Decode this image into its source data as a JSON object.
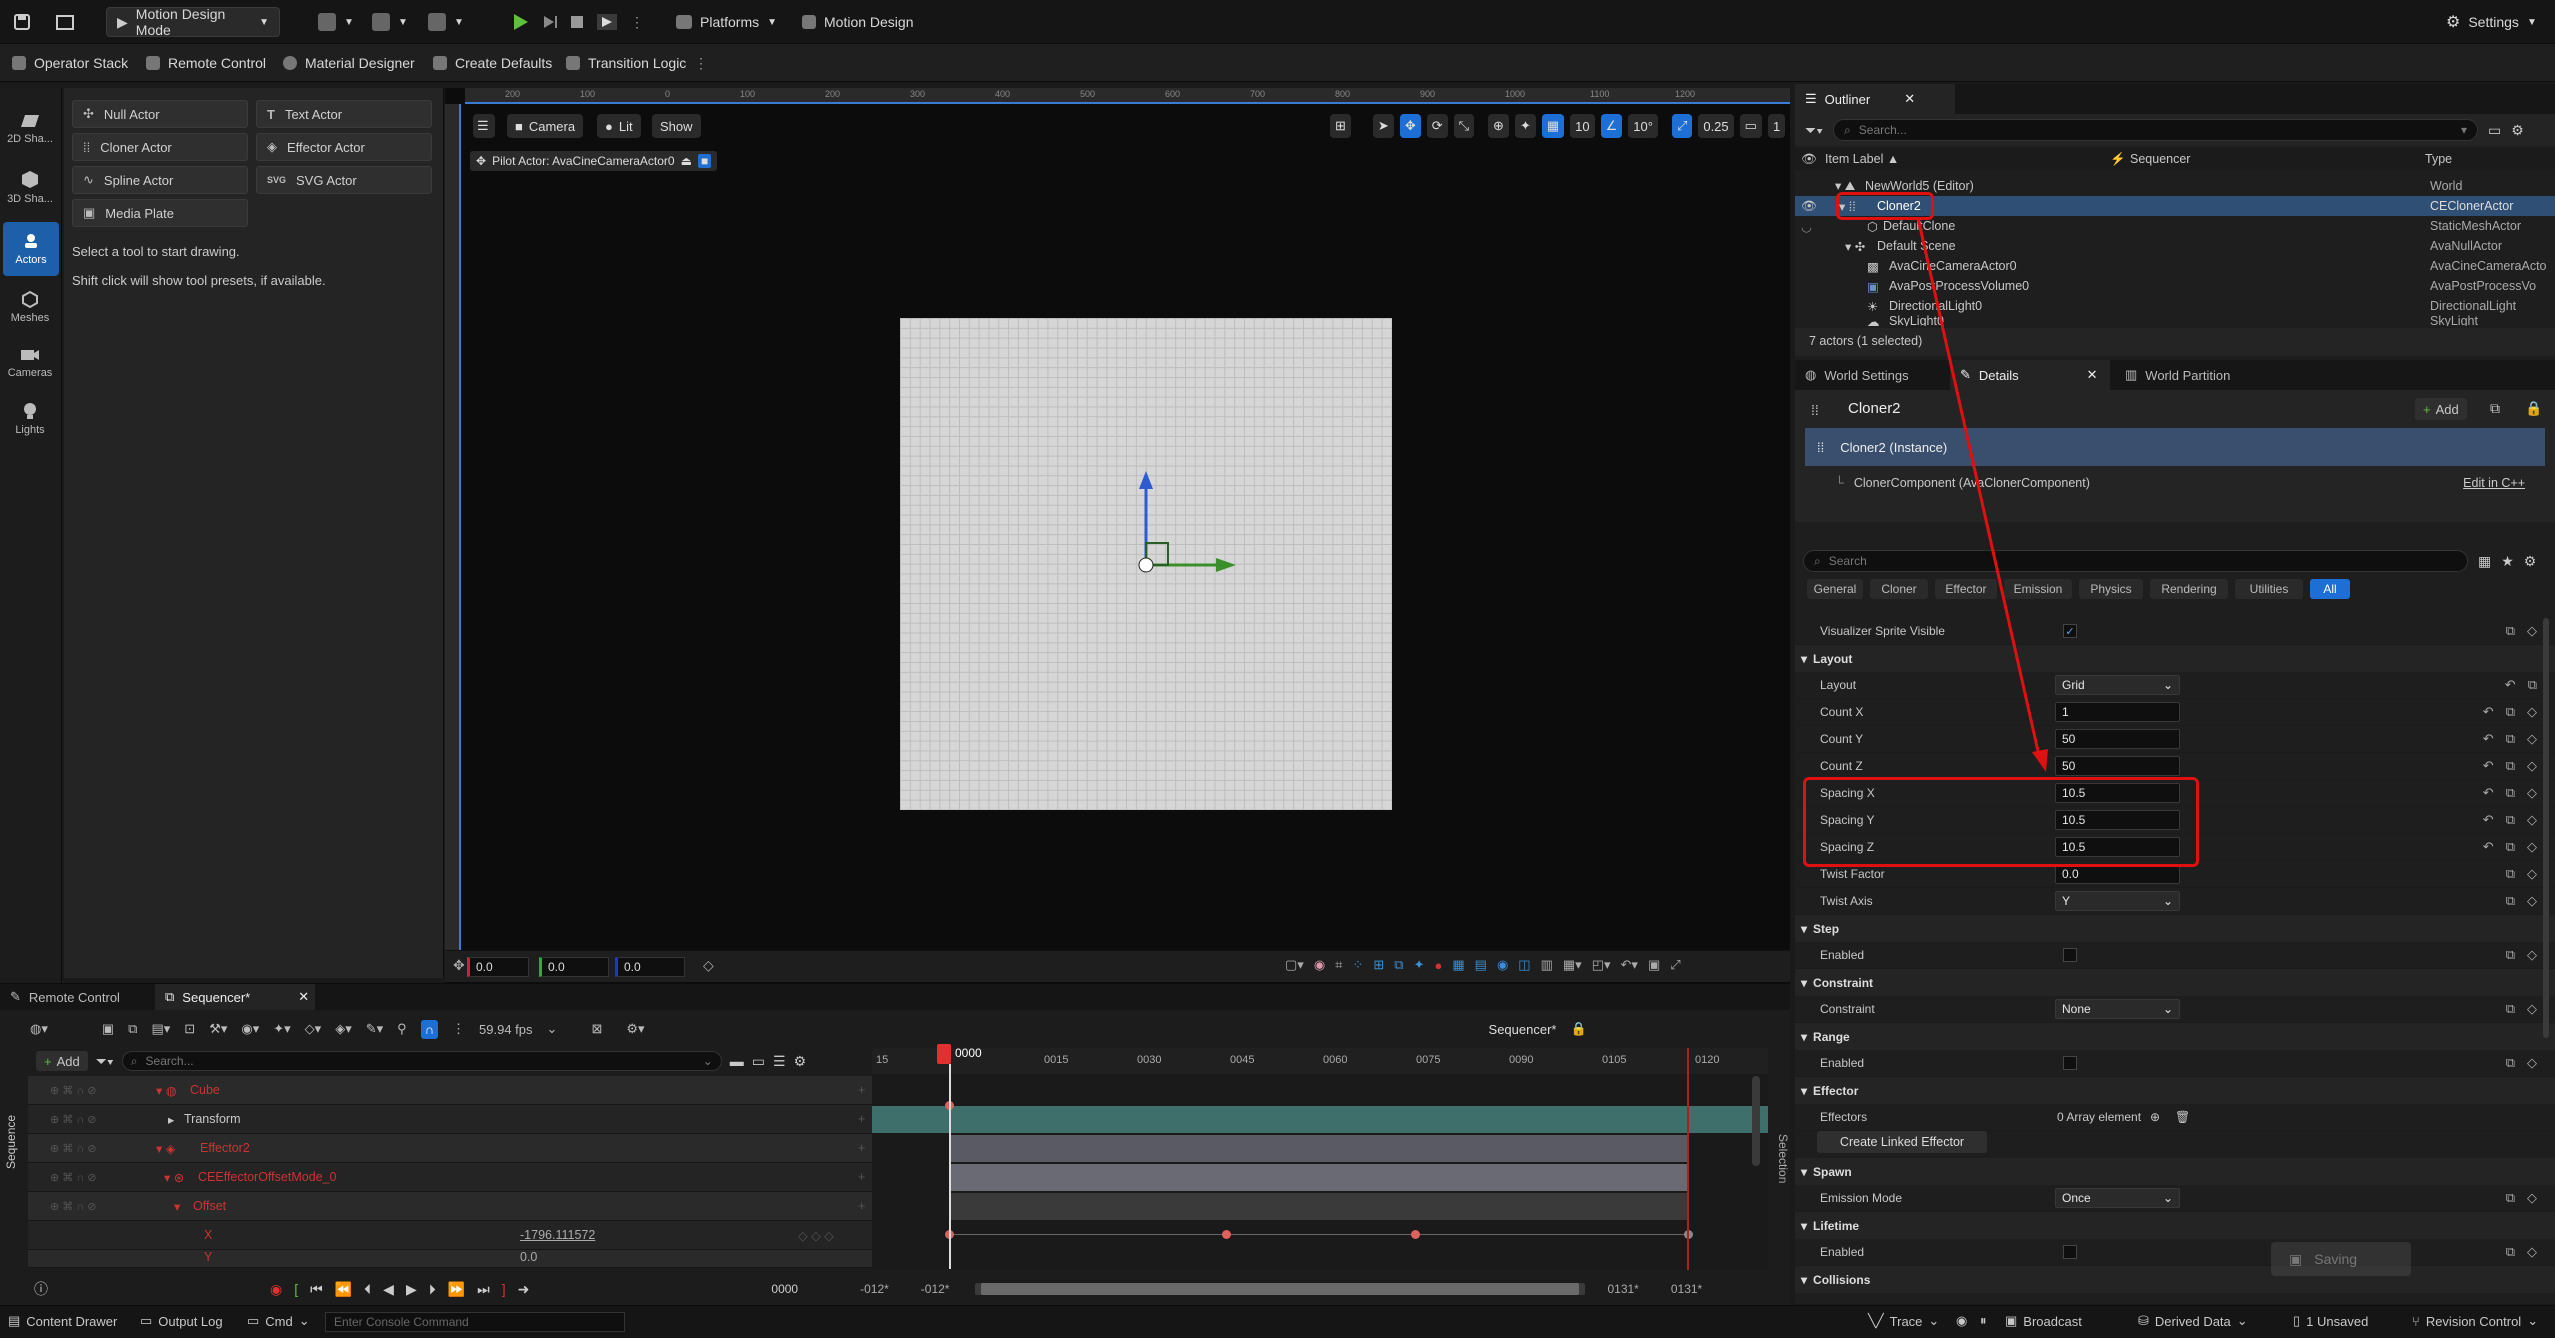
{
  "toolbar": {
    "mode": "Motion Design Mode",
    "platforms": "Platforms",
    "motion_design": "Motion Design",
    "settings": "Settings"
  },
  "toolbar2": {
    "items": [
      "Operator Stack",
      "Remote Control",
      "Material Designer",
      "Create Defaults",
      "Transition Logic"
    ]
  },
  "left_strip": {
    "items": [
      "2D Sha...",
      "3D Sha...",
      "Actors",
      "Meshes",
      "Cameras",
      "Lights"
    ],
    "selected": "Actors"
  },
  "tools": {
    "actors": [
      "Null Actor",
      "Text Actor",
      "Cloner Actor",
      "Effector Actor",
      "Spline Actor",
      "SVG Actor",
      "Media Plate"
    ],
    "hint1": "Select a tool to start drawing.",
    "hint2": "Shift click will show tool presets, if available."
  },
  "viewport": {
    "camera": "Camera",
    "lit": "Lit",
    "show": "Show",
    "pilot": "Pilot Actor: AvaCineCameraActor0",
    "grid_snap": "10",
    "rot_snap": "10°",
    "scale_snap": "0.25",
    "cam_speed": "1",
    "ruler_ticks": [
      "200",
      "100",
      "0",
      "100",
      "200",
      "300",
      "400",
      "500",
      "600",
      "700",
      "800",
      "900",
      "1000",
      "1100",
      "1200"
    ],
    "coords": [
      "0.0",
      "0.0",
      "0.0"
    ]
  },
  "outliner": {
    "tab": "Outliner",
    "search_placeholder": "Search...",
    "col_label": "Item Label ▲",
    "col_seq": "Sequencer",
    "col_type": "Type",
    "rows": [
      {
        "label": "NewWorld5 (Editor)",
        "type": "World"
      },
      {
        "label": "Cloner2",
        "type": "CEClonerActor"
      },
      {
        "label": "DefaultClone",
        "type": "StaticMeshActor"
      },
      {
        "label": "Default Scene",
        "type": "AvaNullActor"
      },
      {
        "label": "AvaCineCameraActor0",
        "type": "AvaCineCameraActo"
      },
      {
        "label": "AvaPostProcessVolume0",
        "type": "AvaPostProcessVo"
      },
      {
        "label": "DirectionalLight0",
        "type": "DirectionalLight"
      },
      {
        "label": "SkyLight0",
        "type": "SkyLight"
      }
    ],
    "count": "7 actors (1 selected)"
  },
  "details": {
    "tabs": [
      "World Settings",
      "Details",
      "World Partition"
    ],
    "actor": "Cloner2",
    "add": "Add",
    "instance": "Cloner2 (Instance)",
    "component": "ClonerComponent (AvaClonerComponent)",
    "edit_cpp": "Edit in C++",
    "search_placeholder": "Search",
    "filters": [
      "General",
      "Cloner",
      "Effector",
      "Emission",
      "Physics",
      "Rendering",
      "Utilities",
      "All"
    ],
    "visualizer": "Visualizer Sprite Visible",
    "cat_layout": "Layout",
    "layout_label": "Layout",
    "layout_val": "Grid",
    "count_x_label": "Count X",
    "count_x": "1",
    "count_y_label": "Count Y",
    "count_y": "50",
    "count_z_label": "Count Z",
    "count_z": "50",
    "spacing_x_label": "Spacing X",
    "spacing_x": "10.5",
    "spacing_y_label": "Spacing Y",
    "spacing_y": "10.5",
    "spacing_z_label": "Spacing Z",
    "spacing_z": "10.5",
    "twist_factor_label": "Twist Factor",
    "twist_factor": "0.0",
    "twist_axis_label": "Twist Axis",
    "twist_axis": "Y",
    "cat_step": "Step",
    "enabled": "Enabled",
    "cat_constraint": "Constraint",
    "constraint_label": "Constraint",
    "constraint_val": "None",
    "cat_range": "Range",
    "cat_effector": "Effector",
    "effectors_label": "Effectors",
    "effectors_val": "0 Array element",
    "create_linked": "Create Linked Effector",
    "cat_spawn": "Spawn",
    "emission_label": "Emission Mode",
    "emission_val": "Once",
    "cat_lifetime": "Lifetime",
    "cat_collisions": "Collisions",
    "saving": "Saving"
  },
  "sequencer": {
    "tab_remote": "Remote Control",
    "tab_seq": "Sequencer*",
    "side": "Sequence",
    "add": "Add",
    "search_placeholder": "Search...",
    "fps": "59.94 fps",
    "seq_name": "Sequencer*",
    "playhead": "0000",
    "time_ticks": [
      "15",
      "0015",
      "0030",
      "0045",
      "0060",
      "0075",
      "0090",
      "0105",
      "0120"
    ],
    "rows": [
      {
        "label": "Cube"
      },
      {
        "label": "Transform"
      },
      {
        "label": "Effector2"
      },
      {
        "label": "CEEffectorOffsetMode_0"
      },
      {
        "label": "Offset"
      },
      {
        "label": "X",
        "value": "-1796.111572"
      },
      {
        "label": "Y",
        "value": "0.0"
      }
    ],
    "current_frame": "0000",
    "start_a": "-012*",
    "start_b": "-012*",
    "end_a": "0131*",
    "end_b": "0131*",
    "selection": "Selection"
  },
  "statusbar": {
    "content_drawer": "Content Drawer",
    "output_log": "Output Log",
    "cmd": "Cmd",
    "console_placeholder": "Enter Console Command",
    "trace": "Trace",
    "broadcast": "Broadcast",
    "derived": "Derived Data",
    "unsaved": "1 Unsaved",
    "revision": "Revision Control"
  },
  "colors": {
    "accent": "#1d6fd6",
    "highlight": "#e01010",
    "selection": "#2f4f75"
  }
}
